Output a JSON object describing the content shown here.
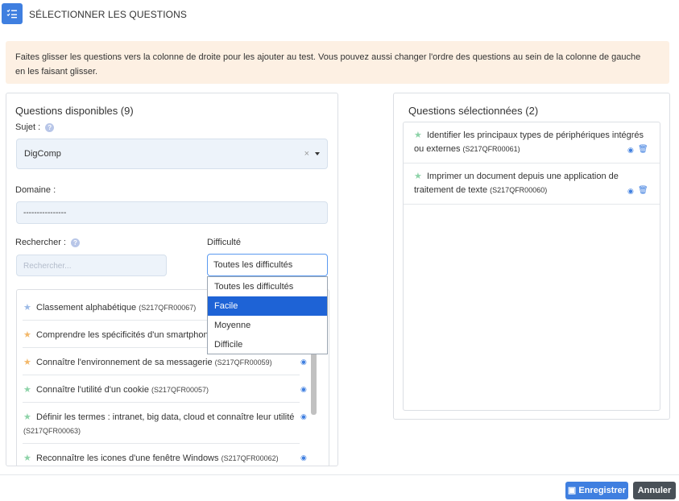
{
  "header": {
    "title": "SÉLECTIONNER LES QUESTIONS",
    "icon": "checklist-icon"
  },
  "info": {
    "text": "Faites glisser les questions vers la colonne de droite pour les ajouter au test. Vous pouvez aussi changer l'ordre des questions au sein de la colonne de gauche en les faisant glisser."
  },
  "left": {
    "title": "Questions disponibles (9)",
    "subject_label": "Sujet :",
    "subject_value": "DigComp",
    "domain_label": "Domaine :",
    "domain_value": "----------------",
    "search_label": "Rechercher :",
    "search_placeholder": "Rechercher...",
    "difficulty_label": "Difficulté",
    "difficulty_value": "Toutes les difficultés",
    "difficulty_options": [
      "Toutes les difficultés",
      "Facile",
      "Moyenne",
      "Difficile"
    ],
    "questions": [
      {
        "text": "Classement alphabétique",
        "code": "(S217QFR00067)",
        "level": "blue"
      },
      {
        "text": "Comprendre les spécificités d'un smartphone",
        "code": "",
        "level": "orange"
      },
      {
        "text": "Connaître l'environnement de sa messagerie",
        "code": "(S217QFR00059)",
        "level": "orange"
      },
      {
        "text": "Connaître l'utilité d'un cookie",
        "code": "(S217QFR00057)",
        "level": "green"
      },
      {
        "text": "Définir les termes : intranet, big data, cloud et connaître leur utilité",
        "code": "(S217QFR00063)",
        "level": "green"
      },
      {
        "text": "Reconnaître les icones d'une fenêtre Windows",
        "code": "(S217QFR00062)",
        "level": "green"
      }
    ]
  },
  "right": {
    "title": "Questions sélectionnées (2)",
    "questions": [
      {
        "text": "Identifier les principaux types de périphériques intégrés ou externes",
        "code": "(S217QFR00061)"
      },
      {
        "text": "Imprimer un document depuis une application de traitement de texte",
        "code": "(S217QFR00060)"
      }
    ]
  },
  "footer": {
    "save_label": "Enregistrer",
    "cancel_label": "Annuler"
  },
  "colors": {
    "accent": "#3f7fe0",
    "info_bg": "#fdf0e3",
    "selected_option": "#1e63d6",
    "cancel": "#495057"
  }
}
